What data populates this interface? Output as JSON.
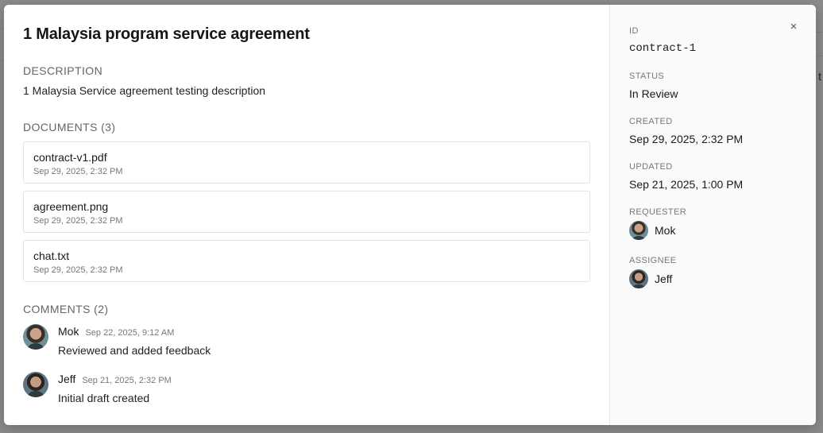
{
  "backdrop": {
    "edge_text": "t"
  },
  "contract": {
    "title": "1 Malaysia program service agreement",
    "description_label": "DESCRIPTION",
    "description": "1 Malaysia Service agreement testing description",
    "documents_label": "DOCUMENTS (3)",
    "documents": [
      {
        "name": "contract-v1.pdf",
        "date": "Sep 29, 2025, 2:32 PM"
      },
      {
        "name": "agreement.png",
        "date": "Sep 29, 2025, 2:32 PM"
      },
      {
        "name": "chat.txt",
        "date": "Sep 29, 2025, 2:32 PM"
      }
    ],
    "comments_label": "COMMENTS (2)",
    "comments": [
      {
        "author": "Mok",
        "time": "Sep 22, 2025, 9:12 AM",
        "text": "Reviewed and added feedback"
      },
      {
        "author": "Jeff",
        "time": "Sep 21, 2025, 2:32 PM",
        "text": "Initial draft created"
      }
    ]
  },
  "details": {
    "close_icon": "×",
    "id_label": "ID",
    "id": "contract-1",
    "status_label": "STATUS",
    "status": "In Review",
    "created_label": "CREATED",
    "created": "Sep 29, 2025, 2:32 PM",
    "updated_label": "UPDATED",
    "updated": "Sep 21, 2025, 1:00 PM",
    "requester_label": "REQUESTER",
    "requester": "Mok",
    "assignee_label": "ASSIGNEE",
    "assignee": "Jeff"
  }
}
